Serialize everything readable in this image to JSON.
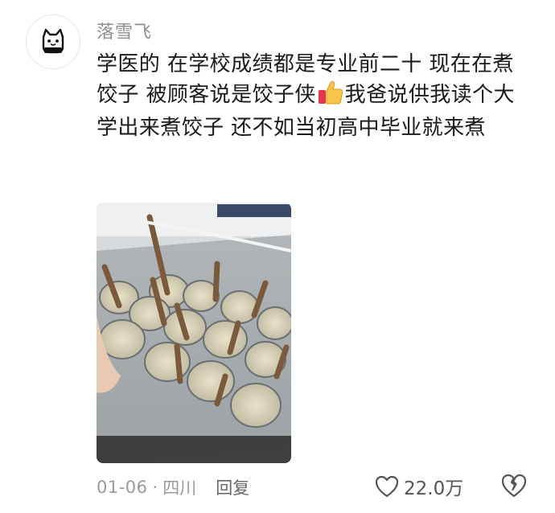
{
  "comment": {
    "username": "落雪飞",
    "text_part1": "学医的 在学校成绩都是专业前二十 现在在煮饺子 被顾客说是饺子侠",
    "thumb_emoji": "thumbs-up-emoji",
    "text_part2": "我爸说供我读个大学出来煮饺子 还不如当初高中毕业就来煮",
    "date": "01-06",
    "separator": "·",
    "location": "四川",
    "reply_label": "回复",
    "like_count": "22.0万"
  },
  "icons": {
    "avatar": "cat-avatar-icon",
    "like": "heart-outline-icon",
    "dislike": "broken-heart-icon"
  },
  "colors": {
    "username": "#8d8d8d",
    "meta": "#9a9a9a",
    "text": "#1a1a1a"
  }
}
